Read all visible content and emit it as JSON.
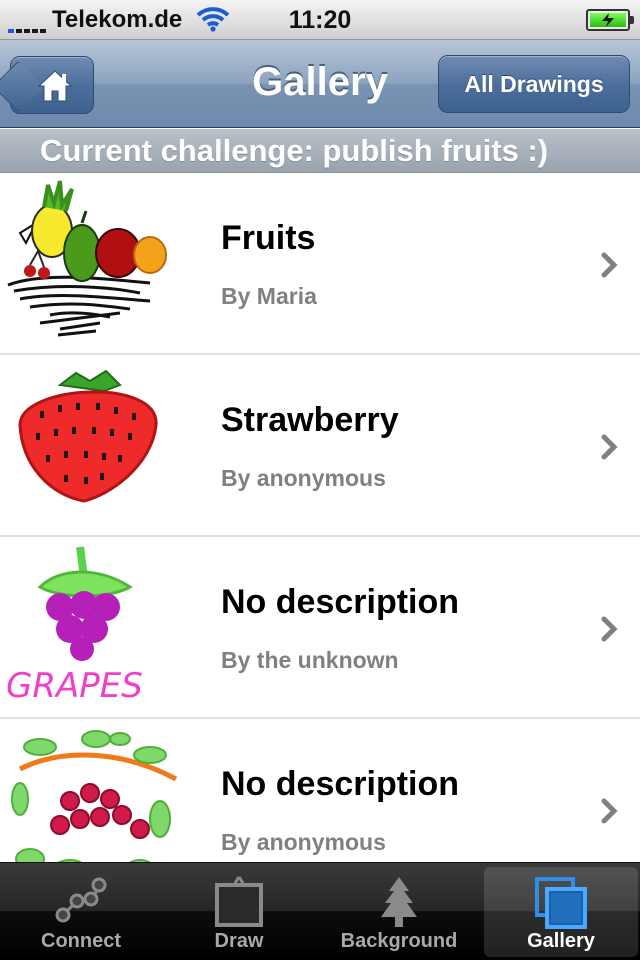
{
  "status_bar": {
    "carrier": "Telekom.de",
    "time": "11:20",
    "signal_bars": 5,
    "battery": "charging"
  },
  "nav": {
    "title": "Gallery",
    "home_icon": "house-icon",
    "right_button": "All Drawings"
  },
  "banner": {
    "text": "Current challenge: publish fruits :)"
  },
  "drawings": [
    {
      "title": "Fruits",
      "author": "By Maria",
      "thumbnail": "fruit-bowl-drawing"
    },
    {
      "title": "Strawberry",
      "author": "By anonymous",
      "thumbnail": "strawberry-drawing"
    },
    {
      "title": "No description",
      "author": "By the unknown",
      "thumbnail": "grapes-drawing",
      "thumbnail_text": "GRAPES"
    },
    {
      "title": "No description",
      "author": "By anonymous",
      "thumbnail": "berry-branch-drawing"
    }
  ],
  "tabs": [
    {
      "label": "Connect",
      "icon": "connect-nodes-icon",
      "selected": false
    },
    {
      "label": "Draw",
      "icon": "easel-icon",
      "selected": false
    },
    {
      "label": "Background",
      "icon": "tree-icon",
      "selected": false
    },
    {
      "label": "Gallery",
      "icon": "gallery-frames-icon",
      "selected": true
    }
  ],
  "colors": {
    "nav_bar": "#7a93b3",
    "tab_selected": "#2f8fe8",
    "subtitle_gray": "#808080"
  }
}
